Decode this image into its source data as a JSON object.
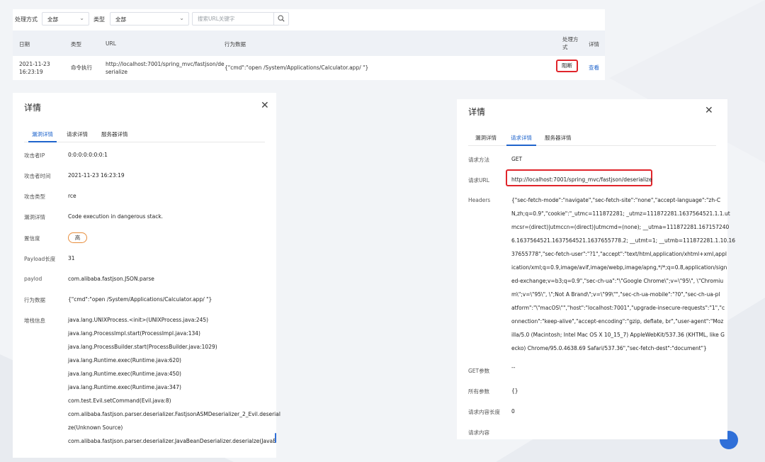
{
  "filter": {
    "method_label": "处理方式",
    "method_value": "全部",
    "type_label": "类型",
    "type_value": "全部",
    "search_placeholder": "搜索URL关键字"
  },
  "table": {
    "headers": {
      "date": "日期",
      "type": "类型",
      "url": "URL",
      "behavior": "行为数据",
      "method_line1": "处理方",
      "method_line2": "式",
      "detail": "详情"
    },
    "row": {
      "date_line1": "2021-11-23",
      "date_line2": "16:23:19",
      "type": "命令执行",
      "url_line1": "http://localhost:7001/spring_mvc/fastjson/de",
      "url_line2": "serialize",
      "behavior": "{\"cmd\":\"open /System/Applications/Calculator.app/ \"}",
      "method": "阻断",
      "detail_link": "查看"
    }
  },
  "left_panel": {
    "title": "详情",
    "tabs": [
      "漏洞详情",
      "请求详情",
      "服务器详情"
    ],
    "active_tab": 0,
    "fields": [
      {
        "label": "攻击者IP",
        "value": "0:0:0:0:0:0:0:1"
      },
      {
        "label": "攻击者时间",
        "value": "2021-11-23 16:23:19"
      },
      {
        "label": "攻击类型",
        "value": "rce"
      },
      {
        "label": "漏洞详情",
        "value": "Code execution in dangerous stack."
      },
      {
        "label": "置信度",
        "value": "高"
      },
      {
        "label": "Payload长度",
        "value": "31"
      },
      {
        "label": "paylod",
        "value": "com.alibaba.fastjson.JSON.parse"
      },
      {
        "label": "行为数据",
        "value": "{\"cmd\":\"open /System/Applications/Calculator.app/ \"}"
      },
      {
        "label": "堆栈信息",
        "value": ""
      }
    ],
    "stack": [
      "java.lang.UNIXProcess.<init>(UNIXProcess.java:245)",
      "java.lang.ProcessImpl.start(ProcessImpl.java:134)",
      "java.lang.ProcessBuilder.start(ProcessBuilder.java:1029)",
      "java.lang.Runtime.exec(Runtime.java:620)",
      "java.lang.Runtime.exec(Runtime.java:450)",
      "java.lang.Runtime.exec(Runtime.java:347)",
      "com.test.Evil.setCommand(Evil.java:8)",
      "com.alibaba.fastjson.parser.deserializer.FastjsonASMDeserializer_2_Evil.deserial",
      "ze(Unknown Source)",
      "com.alibaba.fastjson.parser.deserializer.JavaBeanDeserializer.deserialze(JavaB"
    ]
  },
  "right_panel": {
    "title": "详情",
    "tabs": [
      "漏洞详情",
      "请求详情",
      "服务器详情"
    ],
    "active_tab": 1,
    "request_method_label": "请求方法",
    "request_method": "GET",
    "request_url_label": "请求URL",
    "request_url": "http://localhost:7001/spring_mvc/fastjson/deserialize",
    "headers_label": "Headers",
    "headers_lines": [
      "{\"sec-fetch-mode\":\"navigate\",\"sec-fetch-site\":\"none\",\"accept-language\":\"zh-C",
      "N,zh;q=0.9\",\"cookie\":\"_utmc=111872281; _utmz=111872281.1637564521.1.1.ut",
      "mcsr=(direct)|utmccn=(direct)|utmcmd=(none); __utma=111872281.167157240",
      "6.1637564521.1637564521.1637655778.2; __utmt=1; __utmb=111872281.1.10.16",
      "37655778\",\"sec-fetch-user\":\"?1\",\"accept\":\"text/html,application/xhtml+xml,appl",
      "ication/xml;q=0.9,image/avif,image/webp,image/apng,*/*;q=0.8,application/sign",
      "ed-exchange;v=b3;q=0.9\",\"sec-ch-ua\":\"\\\"Google Chrome\\\";v=\\\"95\\\", \\\"Chromiu",
      "m\\\";v=\\\"95\\\", \\\";Not A Brand\\\";v=\\\"99\\\"\",\"sec-ch-ua-mobile\":\"?0\",\"sec-ch-ua-pl",
      "atform\":\"\\\"macOS\\\"\",\"host\":\"localhost:7001\",\"upgrade-insecure-requests\":\"1\",\"c",
      "onnection\":\"keep-alive\",\"accept-encoding\":\"gzip, deflate, br\",\"user-agent\":\"Moz",
      "illa/5.0 (Macintosh; Intel Mac OS X 10_15_7) AppleWebKit/537.36 (KHTML, like G",
      "ecko) Chrome/95.0.4638.69 Safari/537.36\",\"sec-fetch-dest\":\"document\"}"
    ],
    "get_params_label": "GET参数",
    "get_params": "--",
    "all_params_label": "所有参数",
    "all_params": "{}",
    "content_length_label": "请求内容长度",
    "content_length": "0",
    "content_label": "请求内容",
    "content": ""
  },
  "colors": {
    "accent": "#1f64cc",
    "highlight_red": "#e0252b",
    "badge_orange": "#e88d3c",
    "table_header_bg": "#eef1f6"
  }
}
